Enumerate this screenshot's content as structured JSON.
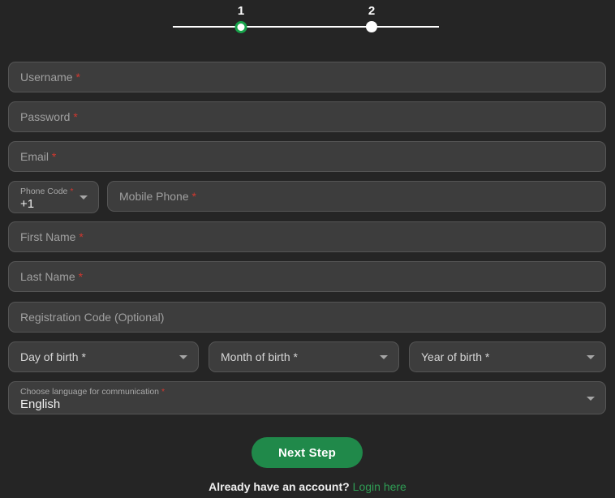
{
  "theme": {
    "background": "#252525",
    "field_bg": "#3d3d3d",
    "field_border": "#555555",
    "placeholder": "#a0a0a0",
    "accent_green": "#20894a",
    "link_green": "#2f9e55",
    "required_red": "#d0382f"
  },
  "stepper": {
    "steps": [
      {
        "label": "1",
        "state": "active"
      },
      {
        "label": "2",
        "state": "inactive"
      }
    ]
  },
  "form": {
    "fields": [
      {
        "name": "username",
        "placeholder": "Username",
        "required": true,
        "value": ""
      },
      {
        "name": "password",
        "placeholder": "Password",
        "required": true,
        "value": ""
      },
      {
        "name": "email",
        "placeholder": "Email",
        "required": true,
        "value": ""
      },
      {
        "name": "phone_code",
        "label": "Phone Code",
        "required": true,
        "value": "+1"
      },
      {
        "name": "mobile_phone",
        "placeholder": "Mobile Phone",
        "required": true,
        "value": ""
      },
      {
        "name": "first_name",
        "placeholder": "First Name",
        "required": true,
        "value": ""
      },
      {
        "name": "last_name",
        "placeholder": "Last Name",
        "required": true,
        "value": ""
      },
      {
        "name": "registration_code",
        "placeholder": "Registration Code (Optional)",
        "required": false,
        "value": ""
      },
      {
        "name": "day_of_birth",
        "placeholder": "Day of birth *",
        "value": ""
      },
      {
        "name": "month_of_birth",
        "placeholder": "Month of birth *",
        "value": ""
      },
      {
        "name": "year_of_birth",
        "placeholder": "Year of birth *",
        "value": ""
      },
      {
        "name": "language",
        "label": "Choose language for communication",
        "required": true,
        "value": "English"
      }
    ],
    "labels": {
      "username": "Username",
      "password": "Password",
      "email": "Email",
      "phone_code": "Phone Code",
      "phone_code_value": "+1",
      "mobile_phone": "Mobile Phone",
      "first_name": "First Name",
      "last_name": "Last Name",
      "registration_code": "Registration Code (Optional)",
      "day_of_birth": "Day of birth *",
      "month_of_birth": "Month of birth *",
      "year_of_birth": "Year of birth *",
      "language_label": "Choose language for communication",
      "language_value": "English",
      "required_mark": "*"
    }
  },
  "actions": {
    "next_step": "Next Step"
  },
  "footer": {
    "prompt": "Already have an account?",
    "login_link": "Login here"
  }
}
